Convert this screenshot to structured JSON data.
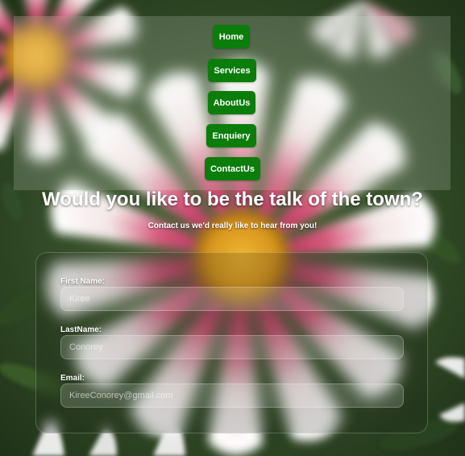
{
  "nav": {
    "items": [
      {
        "label": "Home"
      },
      {
        "label": "Services"
      },
      {
        "label": "AboutUs"
      },
      {
        "label": "Enquiery"
      },
      {
        "label": "ContactUs"
      }
    ]
  },
  "hero": {
    "headline": "Would you like to be the talk of the town?",
    "subline": "Contact us we'd really like to hear from you!"
  },
  "form": {
    "fields": [
      {
        "label": "First Name:",
        "placeholder": "Kiree"
      },
      {
        "label": "LastName:",
        "placeholder": "Conorey"
      },
      {
        "label": "Email:",
        "placeholder": "KireeConorey@gmail.com"
      }
    ]
  },
  "colors": {
    "nav_button": "#0b7d0b",
    "text": "#ffffff"
  },
  "icons": {
    "background": "daisy-flower-photo"
  }
}
